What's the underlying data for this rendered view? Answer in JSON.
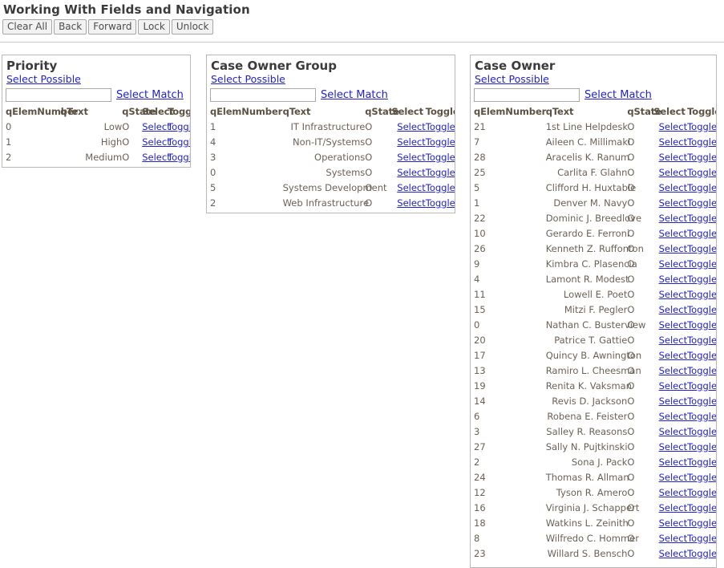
{
  "page": {
    "title": "Working With Fields and Navigation"
  },
  "toolbar": {
    "buttons": [
      {
        "label": "Clear All",
        "name": "clear-all-button"
      },
      {
        "label": "Back",
        "name": "back-button"
      },
      {
        "label": "Forward",
        "name": "forward-button"
      },
      {
        "label": "Lock",
        "name": "lock-button"
      },
      {
        "label": "Unlock",
        "name": "unlock-button"
      }
    ]
  },
  "common": {
    "select_possible_label": "Select Possible",
    "select_match_label": "Select Match",
    "match_input_value": "",
    "match_input_placeholder": "",
    "select_link_label": "Select",
    "toggle_link_label": "Toggle",
    "state_value": "O",
    "columns": {
      "elem_number": "qElemNumber",
      "text": "qText",
      "state": "qState",
      "select": "Select",
      "toggle": "Toggle"
    }
  },
  "panels": [
    {
      "id": "priority",
      "title": "Priority",
      "rows": [
        {
          "qElemNumber": "0",
          "qText": "Low",
          "qState": "O"
        },
        {
          "qElemNumber": "1",
          "qText": "High",
          "qState": "O"
        },
        {
          "qElemNumber": "2",
          "qText": "Medium",
          "qState": "O"
        }
      ]
    },
    {
      "id": "case-owner-group",
      "title": "Case Owner Group",
      "rows": [
        {
          "qElemNumber": "1",
          "qText": "IT Infrastructure",
          "qState": "O"
        },
        {
          "qElemNumber": "4",
          "qText": "Non-IT/Systems",
          "qState": "O"
        },
        {
          "qElemNumber": "3",
          "qText": "Operations",
          "qState": "O"
        },
        {
          "qElemNumber": "0",
          "qText": "Systems",
          "qState": "O"
        },
        {
          "qElemNumber": "5",
          "qText": "Systems Development",
          "qState": "O"
        },
        {
          "qElemNumber": "2",
          "qText": "Web Infrastructure",
          "qState": "O"
        }
      ]
    },
    {
      "id": "case-owner",
      "title": "Case Owner",
      "rows": [
        {
          "qElemNumber": "21",
          "qText": "1st Line Helpdesk",
          "qState": "O"
        },
        {
          "qElemNumber": "7",
          "qText": "Aileen C. Millimaki",
          "qState": "O"
        },
        {
          "qElemNumber": "28",
          "qText": "Aracelis K. Ranum",
          "qState": "O"
        },
        {
          "qElemNumber": "25",
          "qText": "Carlita F. Glahn",
          "qState": "O"
        },
        {
          "qElemNumber": "5",
          "qText": "Clifford H. Huxtable",
          "qState": "O"
        },
        {
          "qElemNumber": "1",
          "qText": "Denver M. Navy",
          "qState": "O"
        },
        {
          "qElemNumber": "22",
          "qText": "Dominic J. Breedlove",
          "qState": "O"
        },
        {
          "qElemNumber": "10",
          "qText": "Gerardo E. Ferroni",
          "qState": "O"
        },
        {
          "qElemNumber": "26",
          "qText": "Kenneth Z. Ruffonton",
          "qState": "O"
        },
        {
          "qElemNumber": "9",
          "qText": "Kimbra C. Plasencia",
          "qState": "O"
        },
        {
          "qElemNumber": "4",
          "qText": "Lamont R. Modest",
          "qState": "O"
        },
        {
          "qElemNumber": "11",
          "qText": "Lowell E. Poet",
          "qState": "O"
        },
        {
          "qElemNumber": "15",
          "qText": "Mitzi F. Pegler",
          "qState": "O"
        },
        {
          "qElemNumber": "0",
          "qText": "Nathan C. Busterview",
          "qState": "O"
        },
        {
          "qElemNumber": "20",
          "qText": "Patrice T. Gattie",
          "qState": "O"
        },
        {
          "qElemNumber": "17",
          "qText": "Quincy B. Awnington",
          "qState": "O"
        },
        {
          "qElemNumber": "13",
          "qText": "Ramiro L. Cheesman",
          "qState": "O"
        },
        {
          "qElemNumber": "19",
          "qText": "Renita K. Vaksman",
          "qState": "O"
        },
        {
          "qElemNumber": "14",
          "qText": "Revis D. Jackson",
          "qState": "O"
        },
        {
          "qElemNumber": "6",
          "qText": "Robena E. Feister",
          "qState": "O"
        },
        {
          "qElemNumber": "3",
          "qText": "Salley R. Reasons",
          "qState": "O"
        },
        {
          "qElemNumber": "27",
          "qText": "Sally N. Pujtkinski",
          "qState": "O"
        },
        {
          "qElemNumber": "2",
          "qText": "Sona J. Pack",
          "qState": "O"
        },
        {
          "qElemNumber": "24",
          "qText": "Thomas R. Allman",
          "qState": "O"
        },
        {
          "qElemNumber": "12",
          "qText": "Tyson R. Amero",
          "qState": "O"
        },
        {
          "qElemNumber": "16",
          "qText": "Virginia J. Schappert",
          "qState": "O"
        },
        {
          "qElemNumber": "18",
          "qText": "Watkins L. Zeinith",
          "qState": "O"
        },
        {
          "qElemNumber": "8",
          "qText": "Wilfredo C. Hommer",
          "qState": "O"
        },
        {
          "qElemNumber": "23",
          "qText": "Willard S. Bensch",
          "qState": "O"
        }
      ]
    }
  ],
  "colors": {
    "link": "#2222cc",
    "heading": "#3b3b3b",
    "column_header": "#5c5243",
    "cell_text": "#6b6257",
    "panel_border": "#b8b8b8"
  }
}
